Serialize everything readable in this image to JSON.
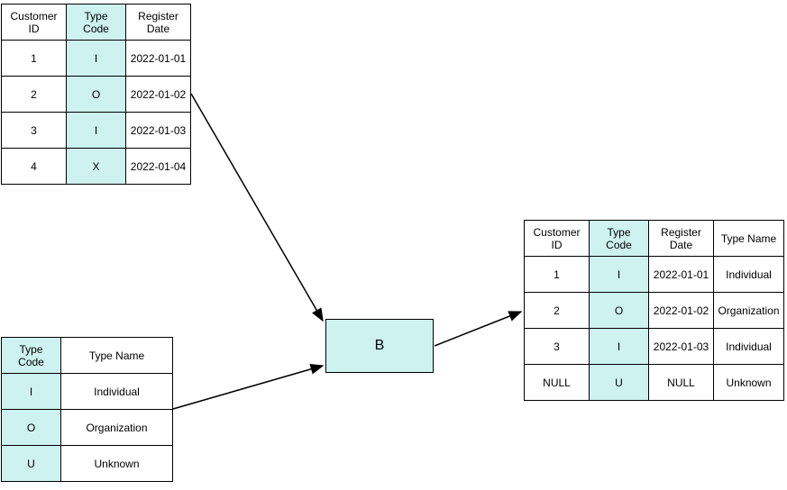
{
  "tables": {
    "customers": {
      "headers": [
        "Customer ID",
        "Type Code",
        "Register Date"
      ],
      "rows": [
        [
          "1",
          "I",
          "2022-01-01"
        ],
        [
          "2",
          "O",
          "2022-01-02"
        ],
        [
          "3",
          "I",
          "2022-01-03"
        ],
        [
          "4",
          "X",
          "2022-01-04"
        ]
      ]
    },
    "types": {
      "headers": [
        "Type Code",
        "Type Name"
      ],
      "rows": [
        [
          "I",
          "Individual"
        ],
        [
          "O",
          "Organization"
        ],
        [
          "U",
          "Unknown"
        ]
      ]
    },
    "result": {
      "headers": [
        "Customer ID",
        "Type Code",
        "Register Date",
        "Type Name"
      ],
      "rows": [
        [
          "1",
          "I",
          "2022-01-01",
          "Individual"
        ],
        [
          "2",
          "O",
          "2022-01-02",
          "Organization"
        ],
        [
          "3",
          "I",
          "2022-01-03",
          "Individual"
        ],
        [
          "NULL",
          "U",
          "NULL",
          "Unknown"
        ]
      ]
    }
  },
  "box": {
    "label": "B"
  }
}
